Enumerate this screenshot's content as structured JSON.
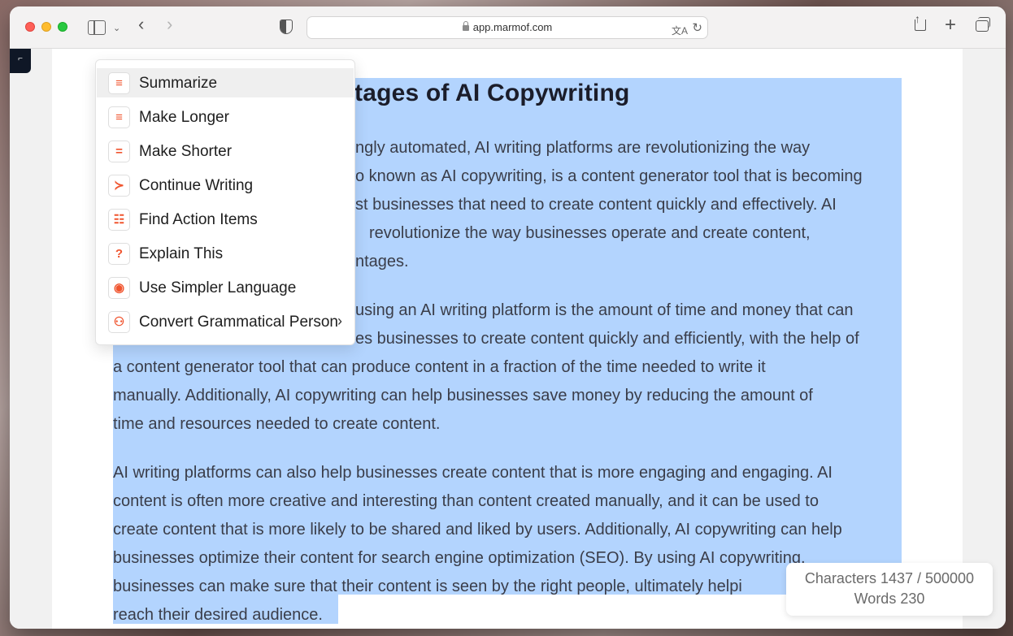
{
  "browser": {
    "url": "app.marmof.com"
  },
  "document": {
    "heading": "tages of AI Copywriting",
    "lines": [
      "ngly automated, AI writing platforms are revolutionizing the way",
      "o known as AI copywriting, is a content generator tool that is becoming",
      "st businesses that need to create content quickly and effectively. AI",
      "revolutionize the way businesses operate and create content,",
      "ntages.",
      "using an AI writing platform is the amount of time and money that can",
      "es businesses to create content quickly and efficiently, with the help of",
      "a content generator tool that can produce content in a fraction of the time needed to write it",
      "manually. Additionally, AI copywriting can help businesses save money by reducing the amount of",
      "time and resources needed to create content.",
      "AI writing platforms can also help businesses create content that is more engaging and engaging. AI",
      "content is often more creative and interesting than content created manually, and it can be used to",
      "create content that is more likely to be shared and liked by users. Additionally, AI copywriting can help",
      "businesses optimize their content for search engine optimization (SEO). By using AI copywriting,",
      "businesses can make sure that their content is seen by the right people, ultimately helpi",
      "reach their desired audience."
    ]
  },
  "menu": {
    "items": [
      {
        "label": "Summarize",
        "icon": "≡"
      },
      {
        "label": "Make Longer",
        "icon": "≡"
      },
      {
        "label": "Make Shorter",
        "icon": "="
      },
      {
        "label": "Continue Writing",
        "icon": "≻"
      },
      {
        "label": "Find Action Items",
        "icon": "☷"
      },
      {
        "label": "Explain This",
        "icon": "?"
      },
      {
        "label": "Use Simpler Language",
        "icon": "◉"
      },
      {
        "label": "Convert Grammatical Person",
        "icon": "⚇"
      }
    ],
    "submenu_chevron": "›"
  },
  "stats": {
    "characters": "Characters 1437 / 500000",
    "words": "Words 230"
  }
}
